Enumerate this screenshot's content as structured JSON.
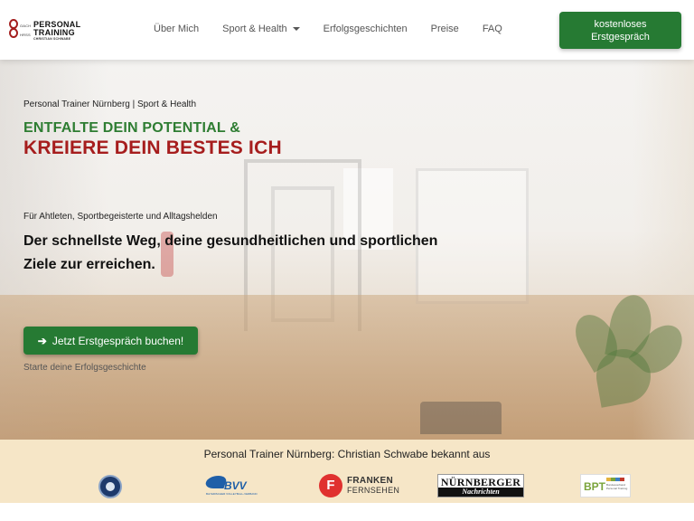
{
  "logo": {
    "mark_top": "OACH",
    "mark_bottom": "HRSS",
    "line1": "PERSONAL",
    "line2": "TRAINING",
    "line3": "CHRISTIAN SCHWABE"
  },
  "nav": {
    "items": [
      {
        "label": "Über Mich"
      },
      {
        "label": "Sport & Health",
        "has_dropdown": true
      },
      {
        "label": "Erfolgsgeschichten"
      },
      {
        "label": "Preise"
      },
      {
        "label": "FAQ"
      }
    ],
    "cta_label": "kostenloses Erstgespräch"
  },
  "hero": {
    "kicker": "Personal Trainer Nürnberg | Sport & Health",
    "headline_green": "ENTFALTE DEIN POTENTIAL &",
    "headline_red": "KREIERE DEIN BESTES ICH",
    "audience": "Für Ahtleten, Sportbegeisterte und Alltagshelden",
    "lead": "Der schnellste Weg, deine gesundheitlichen und sportlichen Ziele zur erreichen.",
    "cta_label": "Jetzt Erstgespräch buchen!",
    "sub_link": "Starte deine Erfolgsgeschichte"
  },
  "press": {
    "title": "Personal Trainer Nürnberg: Christian Schwabe bekannt aus",
    "logos": {
      "bvv": "BVV",
      "bvv_sub": "BAYERISCHER VOLLEYBALL-VERBAND",
      "franken_1": "FRANKEN",
      "franken_2": "FERNSEHEN",
      "nn_1": "NÜRNBERGER",
      "nn_2": "Nachrichten",
      "bpt": "BPT",
      "bpt_sub": "Bundesverband Personal Training"
    }
  },
  "colors": {
    "brand_green": "#267a33",
    "headline_green": "#2e7d32",
    "headline_red": "#a61d1d",
    "strip_bg": "#f6e6c7"
  }
}
